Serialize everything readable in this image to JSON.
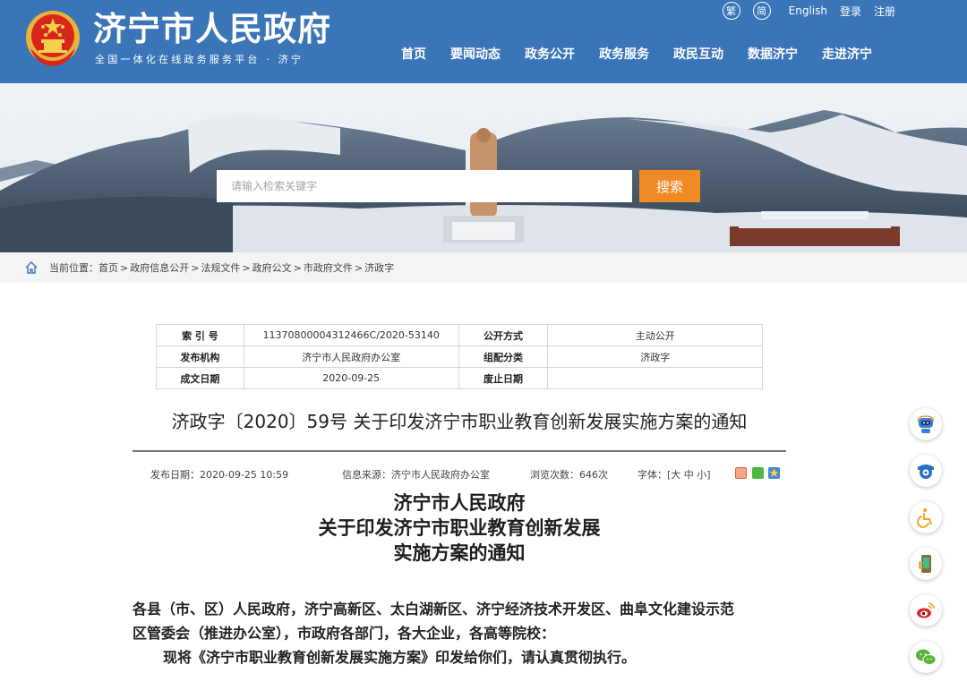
{
  "header": {
    "site_title": "济宁市人民政府",
    "site_subtitle": "全国一体化在线政务服务平台 · 济宁",
    "top_links": {
      "traditional": "繁",
      "simplified": "简",
      "english": "English",
      "login": "登录",
      "register": "注册"
    },
    "nav": [
      "首页",
      "要闻动态",
      "政务公开",
      "政务服务",
      "政民互动",
      "数据济宁",
      "走进济宁"
    ]
  },
  "search": {
    "placeholder": "请输入检索关键字",
    "value": "",
    "button_label": "搜索"
  },
  "breadcrumb": {
    "prefix": "当前位置：",
    "items": [
      "首页",
      "政府信息公开",
      "法规文件",
      "政府公文",
      "市政府文件",
      "济政字"
    ],
    "separator": ">"
  },
  "meta": {
    "rows": [
      {
        "label1": "索 引 号",
        "value1": "11370800004312466C/2020-53140",
        "label2": "公开方式",
        "value2": "主动公开"
      },
      {
        "label1": "发布机构",
        "value1": "济宁市人民政府办公室",
        "label2": "组配分类",
        "value2": "济政字"
      },
      {
        "label1": "成文日期",
        "value1": "2020-09-25",
        "label2": "废止日期",
        "value2": ""
      }
    ]
  },
  "document": {
    "title": "济政字〔2020〕59号 关于印发济宁市职业教育创新发展实施方案的通知",
    "publish_date": "发布日期：2020-09-25 10:59",
    "source": "信息来源：济宁市人民政府办公室",
    "views": "浏览次数：646次",
    "font_size": "字体：[大 中 小]",
    "heading_lines": [
      "济宁市人民政府",
      "关于印发济宁市职业教育创新发展",
      "实施方案的通知"
    ],
    "recipients_line1": "各县（市、区）人民政府，济宁高新区、太白湖新区、济宁经济技术开发区、曲阜文化建设示范",
    "recipients_line2": "区管委会（推进办公室），市政府各部门，各大企业，各高等院校：",
    "body_line1": "现将《济宁市职业教育创新发展实施方案》印发给你们，请认真贯彻执行。"
  },
  "share_icons": [
    "share-weibo-icon",
    "share-wechat-icon",
    "favorite-icon"
  ],
  "float_buttons": [
    "robot-assistant-icon",
    "camera-icon",
    "accessibility-icon",
    "mobile-app-icon",
    "weibo-icon",
    "wechat-icon"
  ],
  "colors": {
    "header_blue": "#3a75b8",
    "search_orange": "#f08a24",
    "breadcrumb_bg": "#f4f4f4"
  }
}
